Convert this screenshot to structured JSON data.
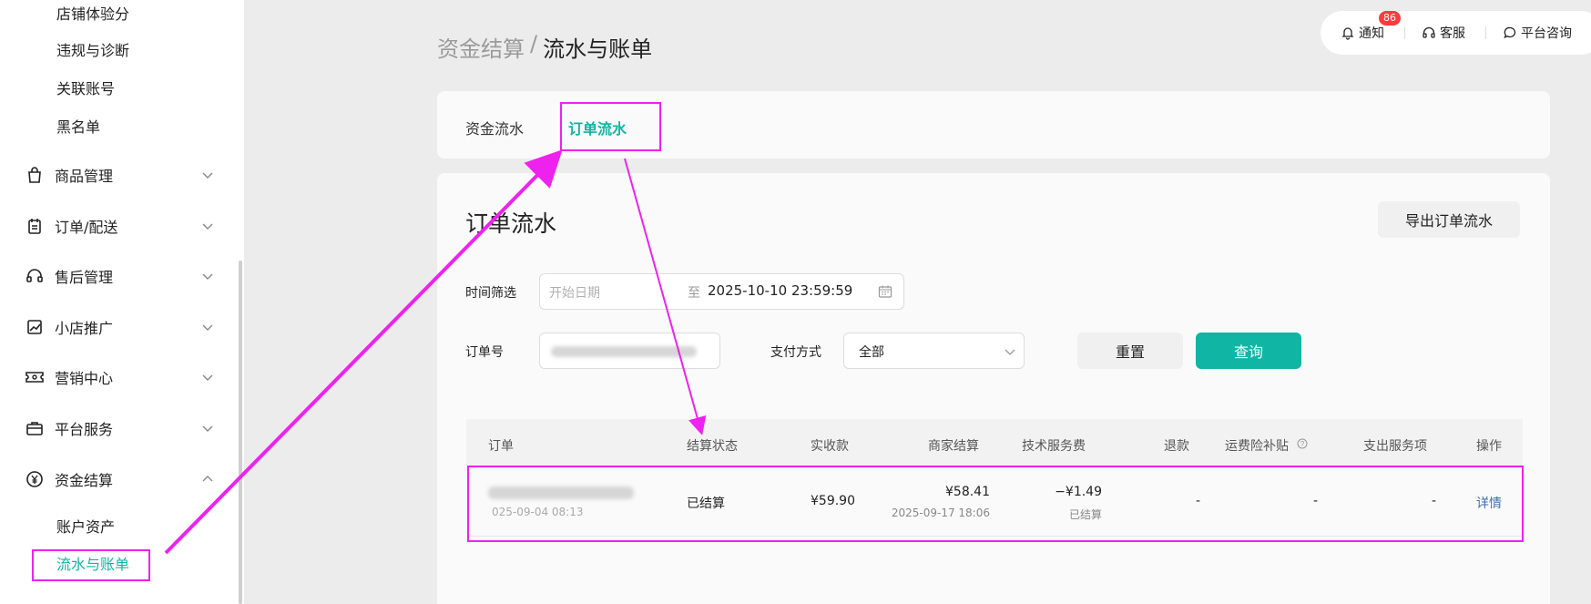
{
  "sidebar": {
    "top_sub_items": [
      "店铺体验分",
      "违规与诊断",
      "关联账号",
      "黑名单"
    ],
    "menus": [
      {
        "label": "商品管理",
        "icon": "bag-icon"
      },
      {
        "label": "订单/配送",
        "icon": "clipboard-icon"
      },
      {
        "label": "售后管理",
        "icon": "headset-icon"
      },
      {
        "label": "小店推广",
        "icon": "trend-chart-icon"
      },
      {
        "label": "营销中心",
        "icon": "ticket-icon"
      },
      {
        "label": "平台服务",
        "icon": "briefcase-icon"
      },
      {
        "label": "资金结算",
        "icon": "yen-circle-icon"
      }
    ],
    "finance_sub_items": [
      "账户资产",
      "流水与账单"
    ],
    "active_color": "#11b5a4"
  },
  "topbar": {
    "notify_label": "通知",
    "notify_count": "86",
    "service_label": "客服",
    "consult_label": "平台咨询"
  },
  "breadcrumb": {
    "parent": "资金结算",
    "separator": "/",
    "current": "流水与账单"
  },
  "tabs": [
    "资金流水",
    "订单流水"
  ],
  "main": {
    "title": "订单流水",
    "export_label": "导出订单流水",
    "filters": {
      "time_label": "时间筛选",
      "start_placeholder": "开始日期",
      "range_separator": "至",
      "end_value": "2025-10-10 23:59:59",
      "order_label": "订单号",
      "pay_label": "支付方式",
      "pay_value": "全部",
      "reset_label": "重置",
      "query_label": "查询"
    },
    "table": {
      "headers": [
        "订单",
        "结算状态",
        "实收款",
        "商家结算",
        "技术服务费",
        "退款",
        "运费险补贴",
        "支出服务项",
        "操作"
      ],
      "rows": [
        {
          "order_time_partial": "025-09-04 08:13",
          "status": "已结算",
          "received": "¥59.90",
          "merchant_settle": "¥58.41",
          "settle_time": "2025-09-17 18:06",
          "tech_fee": "−¥1.49",
          "tech_fee_status": "已结算",
          "refund": "-",
          "shipping_subsidy": "-",
          "expense_items": "-",
          "action": "详情"
        }
      ]
    }
  },
  "annotation_color": "#ee22ee",
  "primary_color": "#11b5a4"
}
